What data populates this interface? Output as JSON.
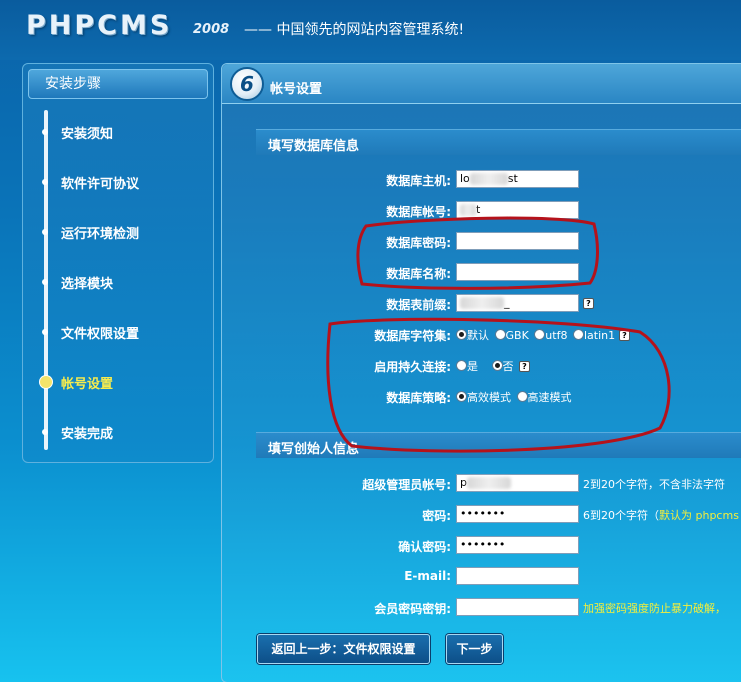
{
  "header": {
    "logo": "PHPCMS",
    "logo_year": "2008",
    "slogan": "—— 中国领先的网站内容管理系统!"
  },
  "sidebar": {
    "title": "安装步骤",
    "steps": [
      {
        "label": "安装须知",
        "active": false
      },
      {
        "label": "软件许可协议",
        "active": false
      },
      {
        "label": "运行环境检测",
        "active": false
      },
      {
        "label": "选择模块",
        "active": false
      },
      {
        "label": "文件权限设置",
        "active": false
      },
      {
        "label": "帐号设置",
        "active": true
      },
      {
        "label": "安装完成",
        "active": false
      }
    ]
  },
  "main": {
    "step_number": "6",
    "title": "帐号设置",
    "db_section": {
      "title": "填写数据库信息",
      "host_label": "数据库主机:",
      "host_value_start": "lo",
      "host_value_end": "st",
      "user_label": "数据库帐号:",
      "user_value_start": "",
      "user_value_end": "t",
      "password_label": "数据库密码:",
      "password_value": "",
      "name_label": "数据库名称:",
      "name_value": "",
      "prefix_label": "数据表前缀:",
      "prefix_value_end": "_",
      "charset_label": "数据库字符集:",
      "charset_options": [
        {
          "label": "默认",
          "selected": true
        },
        {
          "label": "GBK",
          "selected": false
        },
        {
          "label": "utf8",
          "selected": false
        },
        {
          "label": "latin1",
          "selected": false
        }
      ],
      "persistent_label": "启用持久连接:",
      "persistent_options": [
        {
          "label": "是",
          "selected": false
        },
        {
          "label": "否",
          "selected": true
        }
      ],
      "strategy_label": "数据库策略:",
      "strategy_options": [
        {
          "label": "高效模式",
          "selected": true
        },
        {
          "label": "高速模式",
          "selected": false
        }
      ],
      "help_glyph": "?"
    },
    "admin_section": {
      "title": "填写创始人信息",
      "admin_label": "超级管理员帐号:",
      "admin_value_start": "p",
      "admin_hint": "2到20个字符，不含非法字符",
      "password_label": "密码:",
      "password_value": "•••••••",
      "password_hint_prefix": "6到20个字符（",
      "password_hint_default": "默认为 phpcms",
      "confirm_label": "确认密码:",
      "confirm_value": "•••••••",
      "email_label": "E-mail:",
      "email_value": "",
      "member_key_label": "会员密码密钥:",
      "member_key_value": "",
      "member_key_hint": "加强密码强度防止暴力破解，"
    },
    "buttons": {
      "back": "返回上一步：文件权限设置",
      "next": "下一步"
    }
  },
  "colors": {
    "annotation_red": "#b5121b",
    "active_step": "#f7ec4d"
  }
}
